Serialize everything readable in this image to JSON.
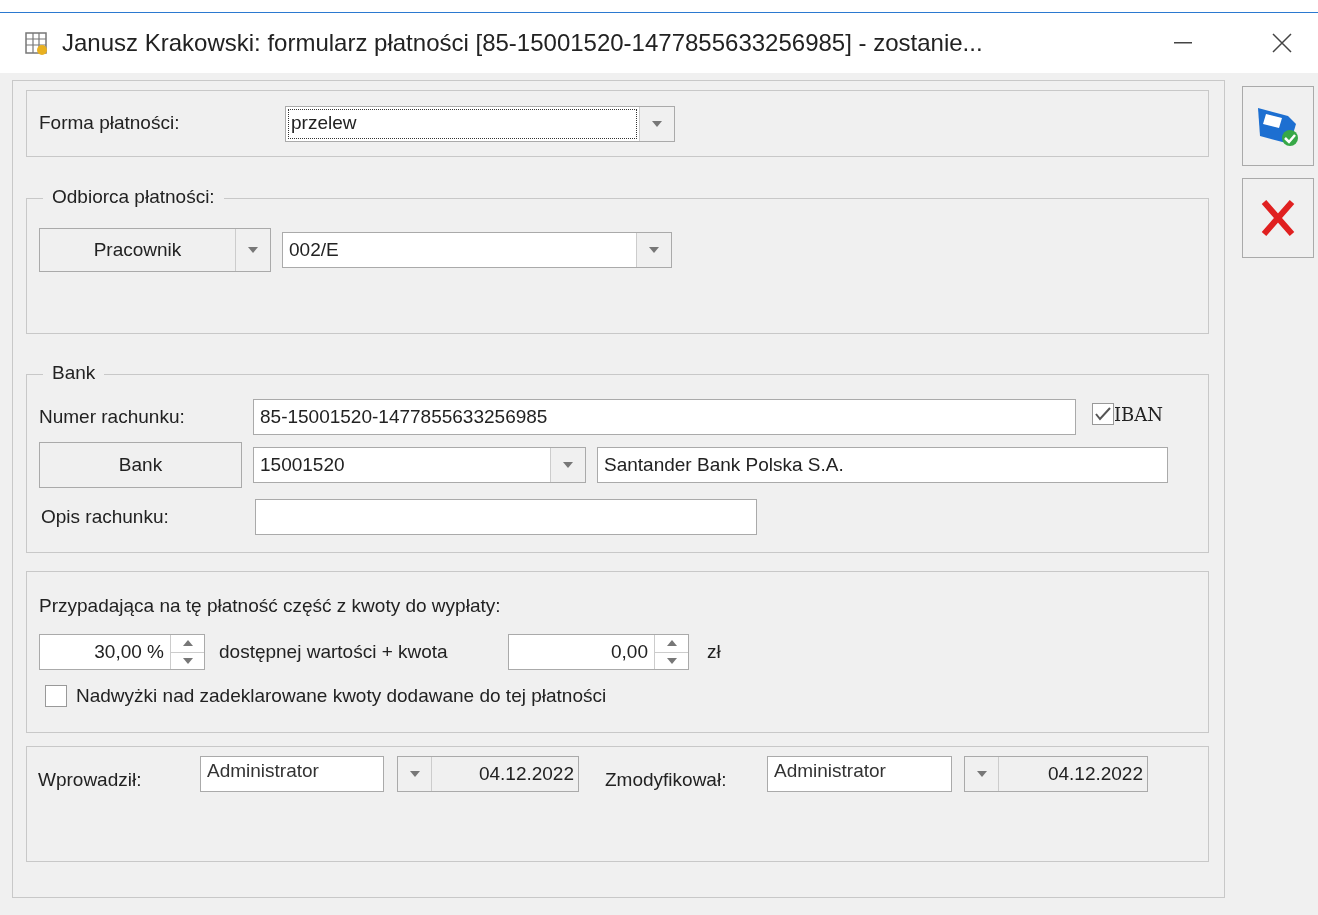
{
  "window": {
    "title": "Janusz Krakowski: formularz płatności [85-15001520-1477855633256985] - zostanie..."
  },
  "payment_form": {
    "label": "Forma płatności:",
    "value": "przelew"
  },
  "recipient": {
    "legend": "Odbiorca płatności:",
    "type_button": "Pracownik",
    "code": "002/E"
  },
  "bank": {
    "legend": "Bank",
    "account_label": "Numer rachunku:",
    "account_number": "85-15001520-1477855633256985",
    "iban": {
      "label": "IBAN",
      "checked": true
    },
    "bank_button": "Bank",
    "bank_code": "15001520",
    "bank_name": "Santander Bank Polska S.A.",
    "description_label": "Opis rachunku:"
  },
  "share": {
    "heading": "Przypadająca na tę płatność część z kwoty do wypłaty:",
    "percent": "30,00 %",
    "middle_text": "dostępnej wartości + kwota",
    "amount": "0,00",
    "currency": "zł",
    "surplus": {
      "label": "Nadwyżki nad zadeklarowane kwoty dodawane do tej płatności",
      "checked": false
    }
  },
  "audit": {
    "entered_label": "Wprowadził:",
    "entered_by": "Administrator",
    "entered_date": "04.12.2022",
    "modified_label": "Zmodyfikował:",
    "modified_by": "Administrator",
    "modified_date": "04.12.2022"
  },
  "toolbar": [
    {
      "kind": "save"
    },
    {
      "kind": "cancel"
    }
  ]
}
